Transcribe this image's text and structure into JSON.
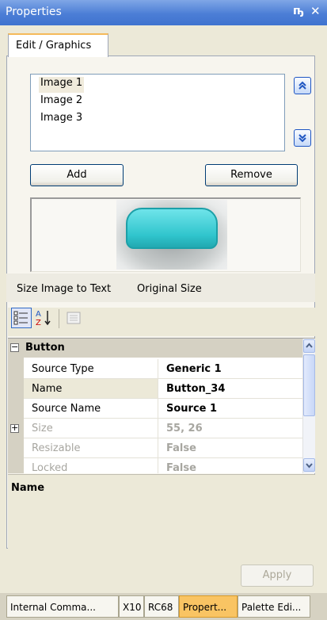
{
  "window": {
    "title": "Properties",
    "pin_icon": "pin-icon",
    "close_icon": "close-icon"
  },
  "tab": {
    "label": "Edit / Graphics"
  },
  "images": {
    "items": [
      "Image 1",
      "Image 2",
      "Image 3"
    ],
    "selected": "Image 1",
    "move_up_icon": "double-chevron-up-icon",
    "move_down_icon": "double-chevron-down-icon"
  },
  "buttons": {
    "add": "Add",
    "remove": "Remove",
    "apply": "Apply"
  },
  "preview": {
    "shape_color": "#2FC4CC"
  },
  "size_links": {
    "size_to_text": "Size Image to Text",
    "original": "Original Size"
  },
  "toolbar": {
    "categorized_icon": "categorized-icon",
    "alphabetical_icon": "alphabetical-az-icon",
    "property_pages_icon": "property-pages-icon"
  },
  "grid": {
    "category": "Button",
    "rows": [
      {
        "label": "Source Type",
        "value": "Generic 1"
      },
      {
        "label": "Name",
        "value": "Button_34"
      },
      {
        "label": "Source Name",
        "value": "Source 1"
      },
      {
        "label": "Size",
        "value": "55, 26"
      },
      {
        "label": "Resizable",
        "value": "False"
      },
      {
        "label": "Locked",
        "value": "False"
      }
    ]
  },
  "description": {
    "title": "Name"
  },
  "dock_tabs": [
    "Internal Comma...",
    "X10",
    "RC68",
    "Propert...",
    "Palette Edi..."
  ],
  "active_dock_tab": "Propert..."
}
